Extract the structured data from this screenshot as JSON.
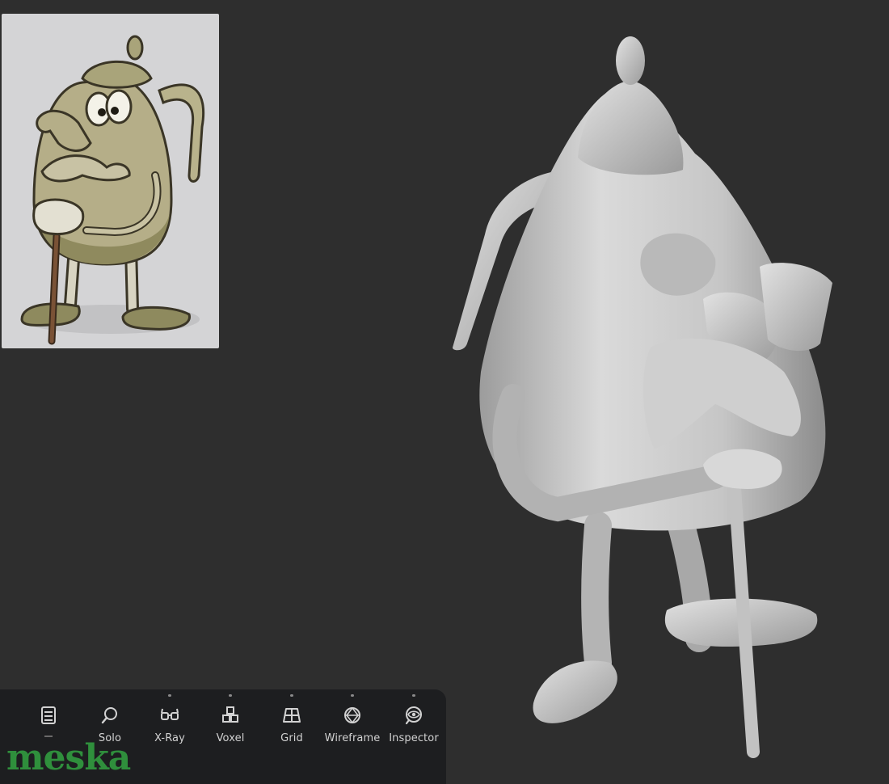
{
  "toolbar": {
    "tools": [
      {
        "icon": "document-icon",
        "label": "",
        "selected": true
      },
      {
        "icon": "search-icon",
        "label": "Solo"
      },
      {
        "icon": "glasses-icon",
        "label": "X-Ray"
      },
      {
        "icon": "cubes-icon",
        "label": "Voxel"
      },
      {
        "icon": "grid-icon",
        "label": "Grid"
      },
      {
        "icon": "sphere-wire-icon",
        "label": "Wireframe"
      },
      {
        "icon": "eye-icon",
        "label": "Inspector"
      }
    ]
  },
  "watermark": {
    "text": "meska",
    "dot_color": "#e8813a",
    "color": "#2f8f3c"
  },
  "colors": {
    "viewport_bg": "#2e2e2e",
    "toolbar_bg": "#1d1e20",
    "model": "#c9c9c9",
    "reference_bg": "#d4d4d6"
  }
}
